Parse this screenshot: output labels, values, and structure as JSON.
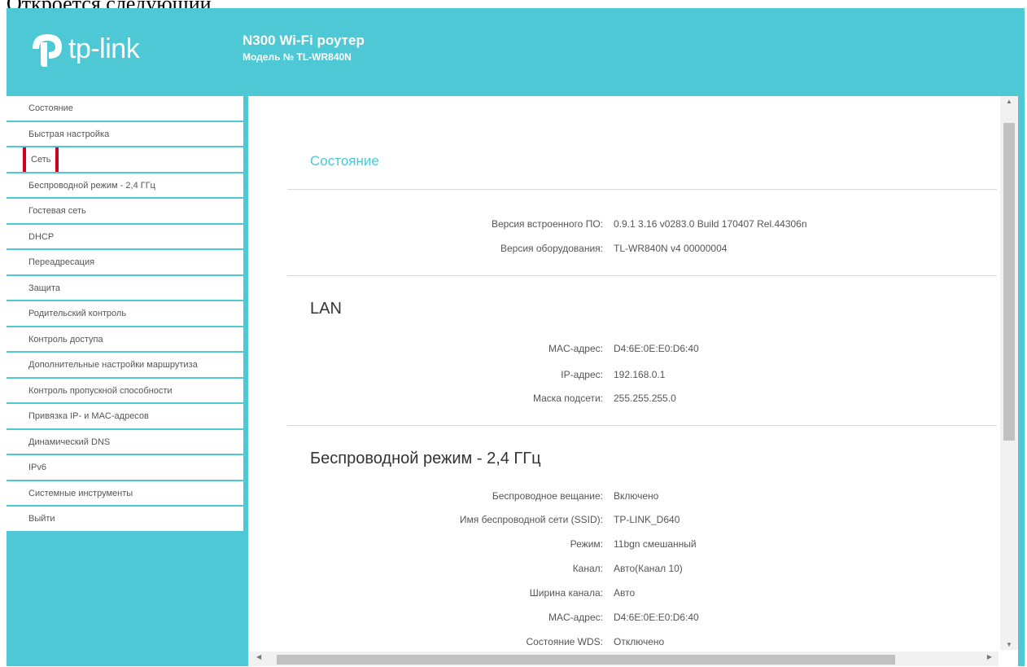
{
  "caption": "Откроется следующий",
  "header": {
    "brand": "tp-link",
    "model_title": "N300 Wi-Fi роутер",
    "model_number": "Модель № TL-WR840N"
  },
  "sidebar": {
    "items": [
      {
        "label": "Состояние"
      },
      {
        "label": "Быстрая настройка"
      },
      {
        "label": "Сеть",
        "highlighted": true
      },
      {
        "label": "Беспроводной режим - 2,4 ГГц"
      },
      {
        "label": "Гостевая сеть"
      },
      {
        "label": "DHCP"
      },
      {
        "label": "Переадресация"
      },
      {
        "label": "Защита"
      },
      {
        "label": "Родительский контроль"
      },
      {
        "label": "Контроль доступа"
      },
      {
        "label": "Дополнительные настройки маршрутиза"
      },
      {
        "label": "Контроль пропускной способности"
      },
      {
        "label": "Привязка IP- и MAC-адресов"
      },
      {
        "label": "Динамический DNS"
      },
      {
        "label": "IPv6"
      },
      {
        "label": "Системные инструменты"
      },
      {
        "label": "Выйти"
      }
    ]
  },
  "main": {
    "status": {
      "title": "Состояние",
      "rows": [
        {
          "key": "Версия встроенного ПО:",
          "value": "0.9.1 3.16 v0283.0 Build 170407 Rel.44306n"
        },
        {
          "key": "Версия оборудования:",
          "value": "TL-WR840N v4 00000004"
        }
      ]
    },
    "lan": {
      "title": "LAN",
      "rows": [
        {
          "key": "MAC-адрес:",
          "value": "D4:6E:0E:E0:D6:40"
        },
        {
          "key": "IP-адрес:",
          "value": "192.168.0.1"
        },
        {
          "key": "Маска подсети:",
          "value": "255.255.255.0"
        }
      ]
    },
    "wireless": {
      "title": "Беспроводной режим - 2,4 ГГц",
      "rows": [
        {
          "key": "Беспроводное вещание:",
          "value": "Включено"
        },
        {
          "key": "Имя беспроводной сети (SSID):",
          "value": "TP-LINK_D640"
        },
        {
          "key": "Режим:",
          "value": "11bgn смешанный"
        },
        {
          "key": "Канал:",
          "value": "Авто(Канал 10)"
        },
        {
          "key": "Ширина канала:",
          "value": "Авто"
        },
        {
          "key": "MAC-адрес:",
          "value": "D4:6E:0E:E0:D6:40"
        },
        {
          "key": "Состояние WDS:",
          "value": "Отключено"
        }
      ]
    }
  },
  "colors": {
    "accent": "#4ec8d4",
    "highlight": "#d0021b"
  }
}
